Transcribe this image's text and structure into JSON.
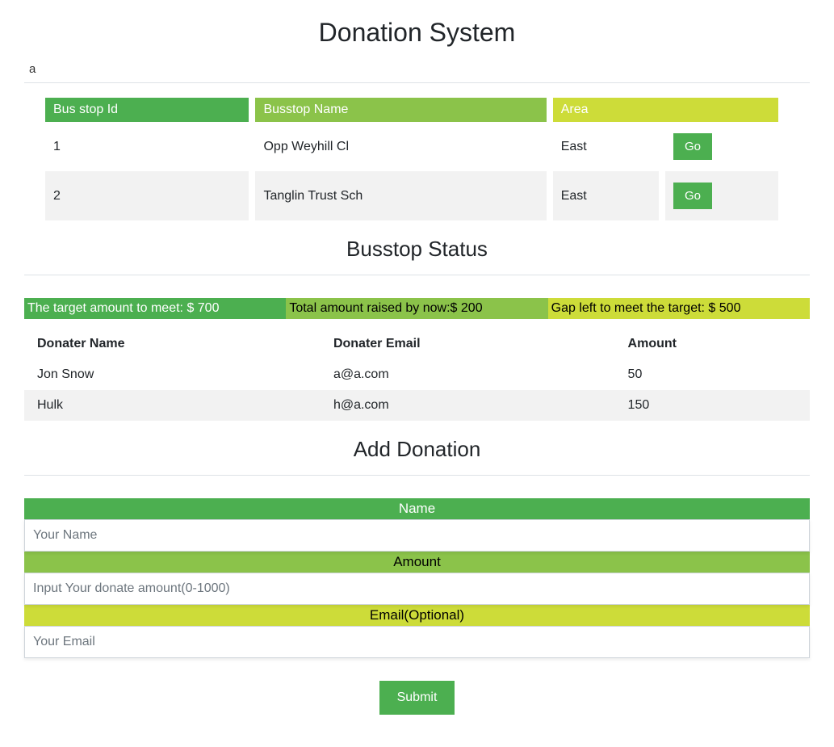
{
  "page": {
    "title": "Donation System"
  },
  "search": {
    "value": "a"
  },
  "busstop_table": {
    "headers": {
      "id": "Bus stop Id",
      "name": "Busstop Name",
      "area": "Area"
    },
    "rows": [
      {
        "id": "1",
        "name": "Opp Weyhill Cl",
        "area": "East",
        "go_label": "Go"
      },
      {
        "id": "2",
        "name": "Tanglin Trust Sch",
        "area": "East",
        "go_label": "Go"
      }
    ]
  },
  "status": {
    "title": "Busstop Status",
    "target_label": "The target amount to meet: $ 700",
    "raised_label": "Total amount raised by now:$ 200",
    "gap_label": "Gap left to meet the target: $ 500"
  },
  "donaters": {
    "headers": {
      "name": "Donater Name",
      "email": "Donater Email",
      "amount": "Amount"
    },
    "rows": [
      {
        "name": "Jon Snow",
        "email": "a@a.com",
        "amount": "50"
      },
      {
        "name": "Hulk",
        "email": "h@a.com",
        "amount": "150"
      }
    ]
  },
  "form": {
    "title": "Add Donation",
    "name_label": "Name",
    "name_placeholder": "Your Name",
    "amount_label": "Amount",
    "amount_placeholder": "Input Your donate amount(0-1000)",
    "email_label": "Email(Optional)",
    "email_placeholder": "Your Email",
    "submit_label": "Submit"
  }
}
